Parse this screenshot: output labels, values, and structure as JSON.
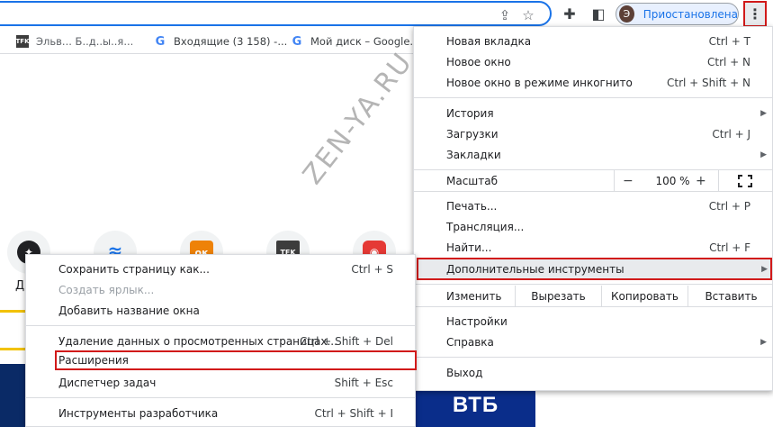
{
  "toolbar": {
    "profile_initial": "Э",
    "profile_status": "Приостановлена",
    "icons": [
      "share-icon",
      "star-icon",
      "extensions-icon",
      "side-panel-icon",
      "more-vert-icon"
    ]
  },
  "bookmarks": [
    {
      "icon": "TFK",
      "label": "Эльв... Б..д..ы..я..."
    },
    {
      "icon": "G",
      "label": "Входящие (3 158) -..."
    },
    {
      "icon": "G",
      "label": "Мой диск – Google..."
    }
  ],
  "page": {
    "tile_label": "Д",
    "tiles": [
      {
        "icon": "compass-icon",
        "glyph": "✦",
        "color": "#202124"
      },
      {
        "icon": "wifi-icon",
        "glyph": "≋",
        "color": "#1a73e8"
      },
      {
        "icon": "odnoklassniki-icon",
        "glyph": "ок",
        "color": "#ee8208"
      },
      {
        "icon": "tfk-icon",
        "glyph": "TFK",
        "color": "#3c3c3c"
      },
      {
        "icon": "red-app-icon",
        "glyph": "◉",
        "color": "#e53935"
      }
    ],
    "vtb_label": "ВТБ"
  },
  "watermark": "ZEN-YA.RU",
  "main_menu": {
    "items_top": [
      {
        "label": "Новая вкладка",
        "shortcut": "Ctrl + T"
      },
      {
        "label": "Новое окно",
        "shortcut": "Ctrl + N"
      },
      {
        "label": "Новое окно в режиме инкогнито",
        "shortcut": "Ctrl + Shift + N"
      }
    ],
    "items_history": [
      {
        "label": "История",
        "shortcut": ""
      },
      {
        "label": "Загрузки",
        "shortcut": "Ctrl + J"
      },
      {
        "label": "Закладки",
        "shortcut": ""
      }
    ],
    "zoom": {
      "label": "Масштаб",
      "minus": "−",
      "value": "100 %",
      "plus": "+"
    },
    "items_print": [
      {
        "label": "Печать...",
        "shortcut": "Ctrl + P"
      },
      {
        "label": "Трансляция...",
        "shortcut": ""
      },
      {
        "label": "Найти...",
        "shortcut": "Ctrl + F"
      },
      {
        "label": "Дополнительные инструменты",
        "shortcut": ""
      }
    ],
    "edit": {
      "label": "Изменить",
      "cut": "Вырезать",
      "copy": "Копировать",
      "paste": "Вставить"
    },
    "items_settings": [
      {
        "label": "Настройки",
        "shortcut": ""
      },
      {
        "label": "Справка",
        "shortcut": ""
      }
    ],
    "exit": {
      "label": "Выход"
    }
  },
  "sub_menu": {
    "items_a": [
      {
        "label": "Сохранить страницу как...",
        "shortcut": "Ctrl + S"
      },
      {
        "label": "Создать ярлык...",
        "shortcut": ""
      },
      {
        "label": "Добавить название окна",
        "shortcut": ""
      }
    ],
    "items_b": [
      {
        "label": "Удаление данных о просмотренных страницах...",
        "shortcut": "Ctrl + Shift + Del"
      },
      {
        "label": "Расширения",
        "shortcut": ""
      },
      {
        "label": "Диспетчер задач",
        "shortcut": "Shift + Esc"
      }
    ],
    "items_c": [
      {
        "label": "Инструменты разработчика",
        "shortcut": "Ctrl + Shift + I"
      }
    ]
  }
}
